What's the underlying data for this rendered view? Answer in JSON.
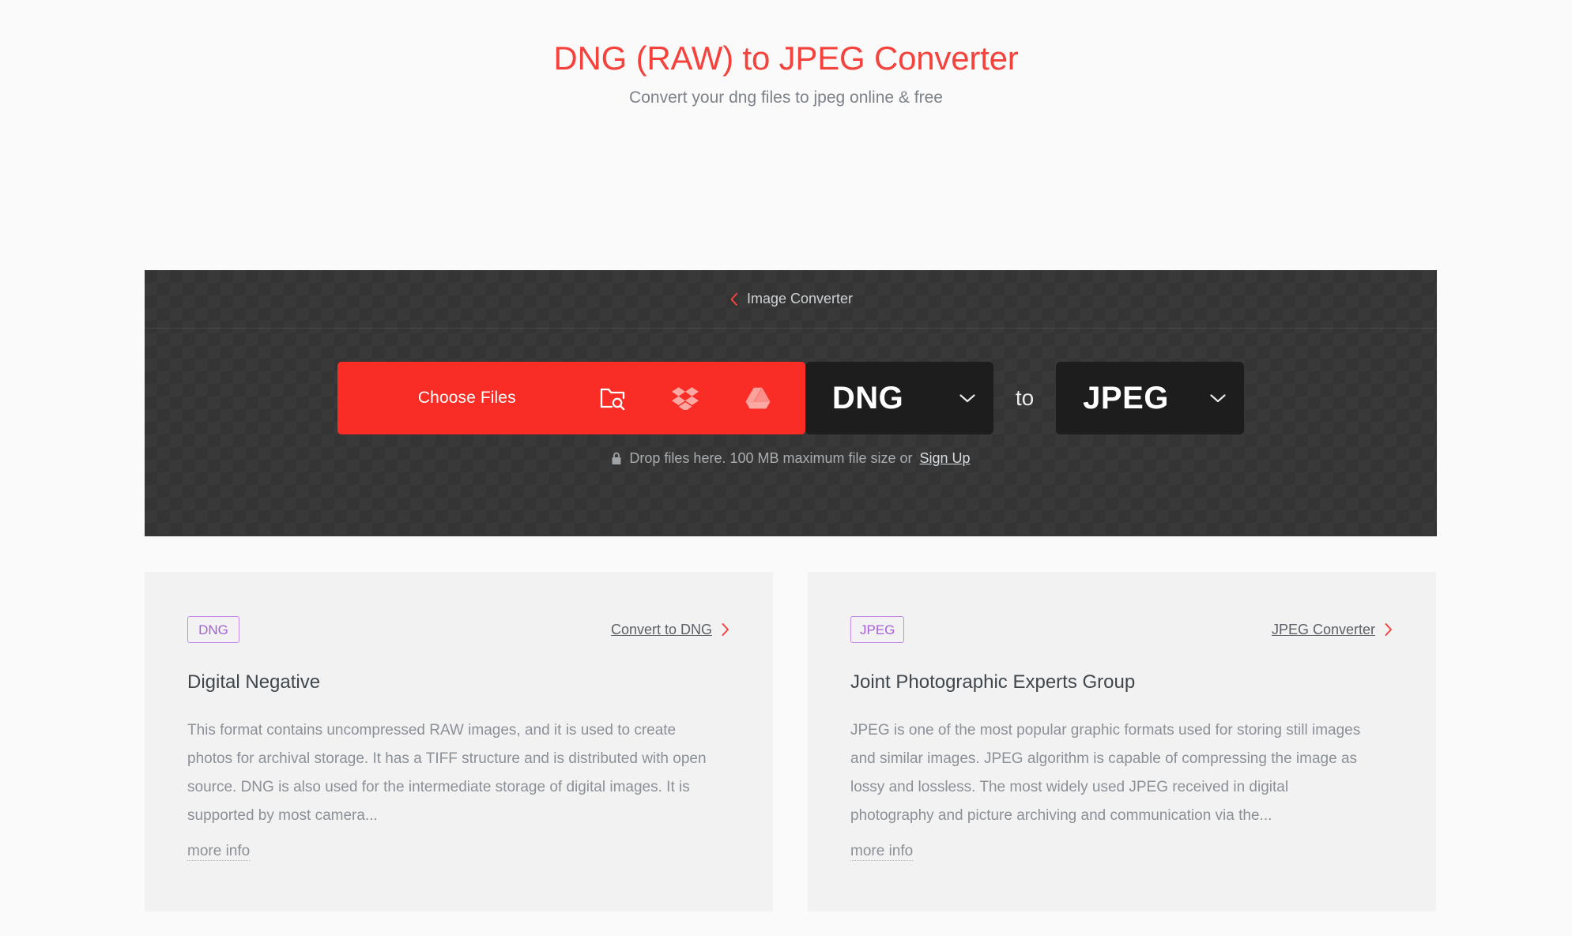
{
  "header": {
    "title": "DNG (RAW) to JPEG Converter",
    "subtitle": "Convert your dng files to jpeg online & free"
  },
  "converter": {
    "breadcrumb": {
      "label": "Image Converter",
      "back_icon": "chevron-left-icon"
    },
    "choose_files": {
      "label": "Choose Files",
      "icons": [
        "folder-search-icon",
        "dropbox-icon",
        "google-drive-icon"
      ]
    },
    "source_format": {
      "value": "DNG",
      "chevron": "chevron-down-icon"
    },
    "separator_word": "to",
    "target_format": {
      "value": "JPEG",
      "chevron": "chevron-down-icon"
    },
    "drop_hint": {
      "lock_icon": "lock-icon",
      "text": "Drop files here. 100 MB maximum file size or",
      "link": "Sign Up"
    }
  },
  "cards": [
    {
      "badge": "DNG",
      "link_label": "Convert to DNG",
      "link_icon": "chevron-right-icon",
      "heading": "Digital Negative",
      "body": "This format contains uncompressed RAW images, and it is used to create photos for archival storage. It has a TIFF structure and is distributed with open source. DNG is also used for the intermediate storage of digital images. It is supported by most camera...",
      "more_info": "more info"
    },
    {
      "badge": "JPEG",
      "link_label": "JPEG Converter",
      "link_icon": "chevron-right-icon",
      "heading": "Joint Photographic Experts Group",
      "body": "JPEG is one of the most popular graphic formats used for storing still images and similar images. JPEG algorithm is capable of compressing the image as lossy and lossless. The most widely used JPEG received in digital photography and picture archiving and communication via the...",
      "more_info": "more info"
    }
  ],
  "colors": {
    "page_background": "#fafafa",
    "title_red": "#f4433c",
    "button_red": "#fa2c26",
    "panel_dark": "#343434",
    "select_dark": "#1d1d1d",
    "card_background": "#f2f2f2",
    "badge_purple": "#a65fd8",
    "body_text": "#8b9097"
  }
}
